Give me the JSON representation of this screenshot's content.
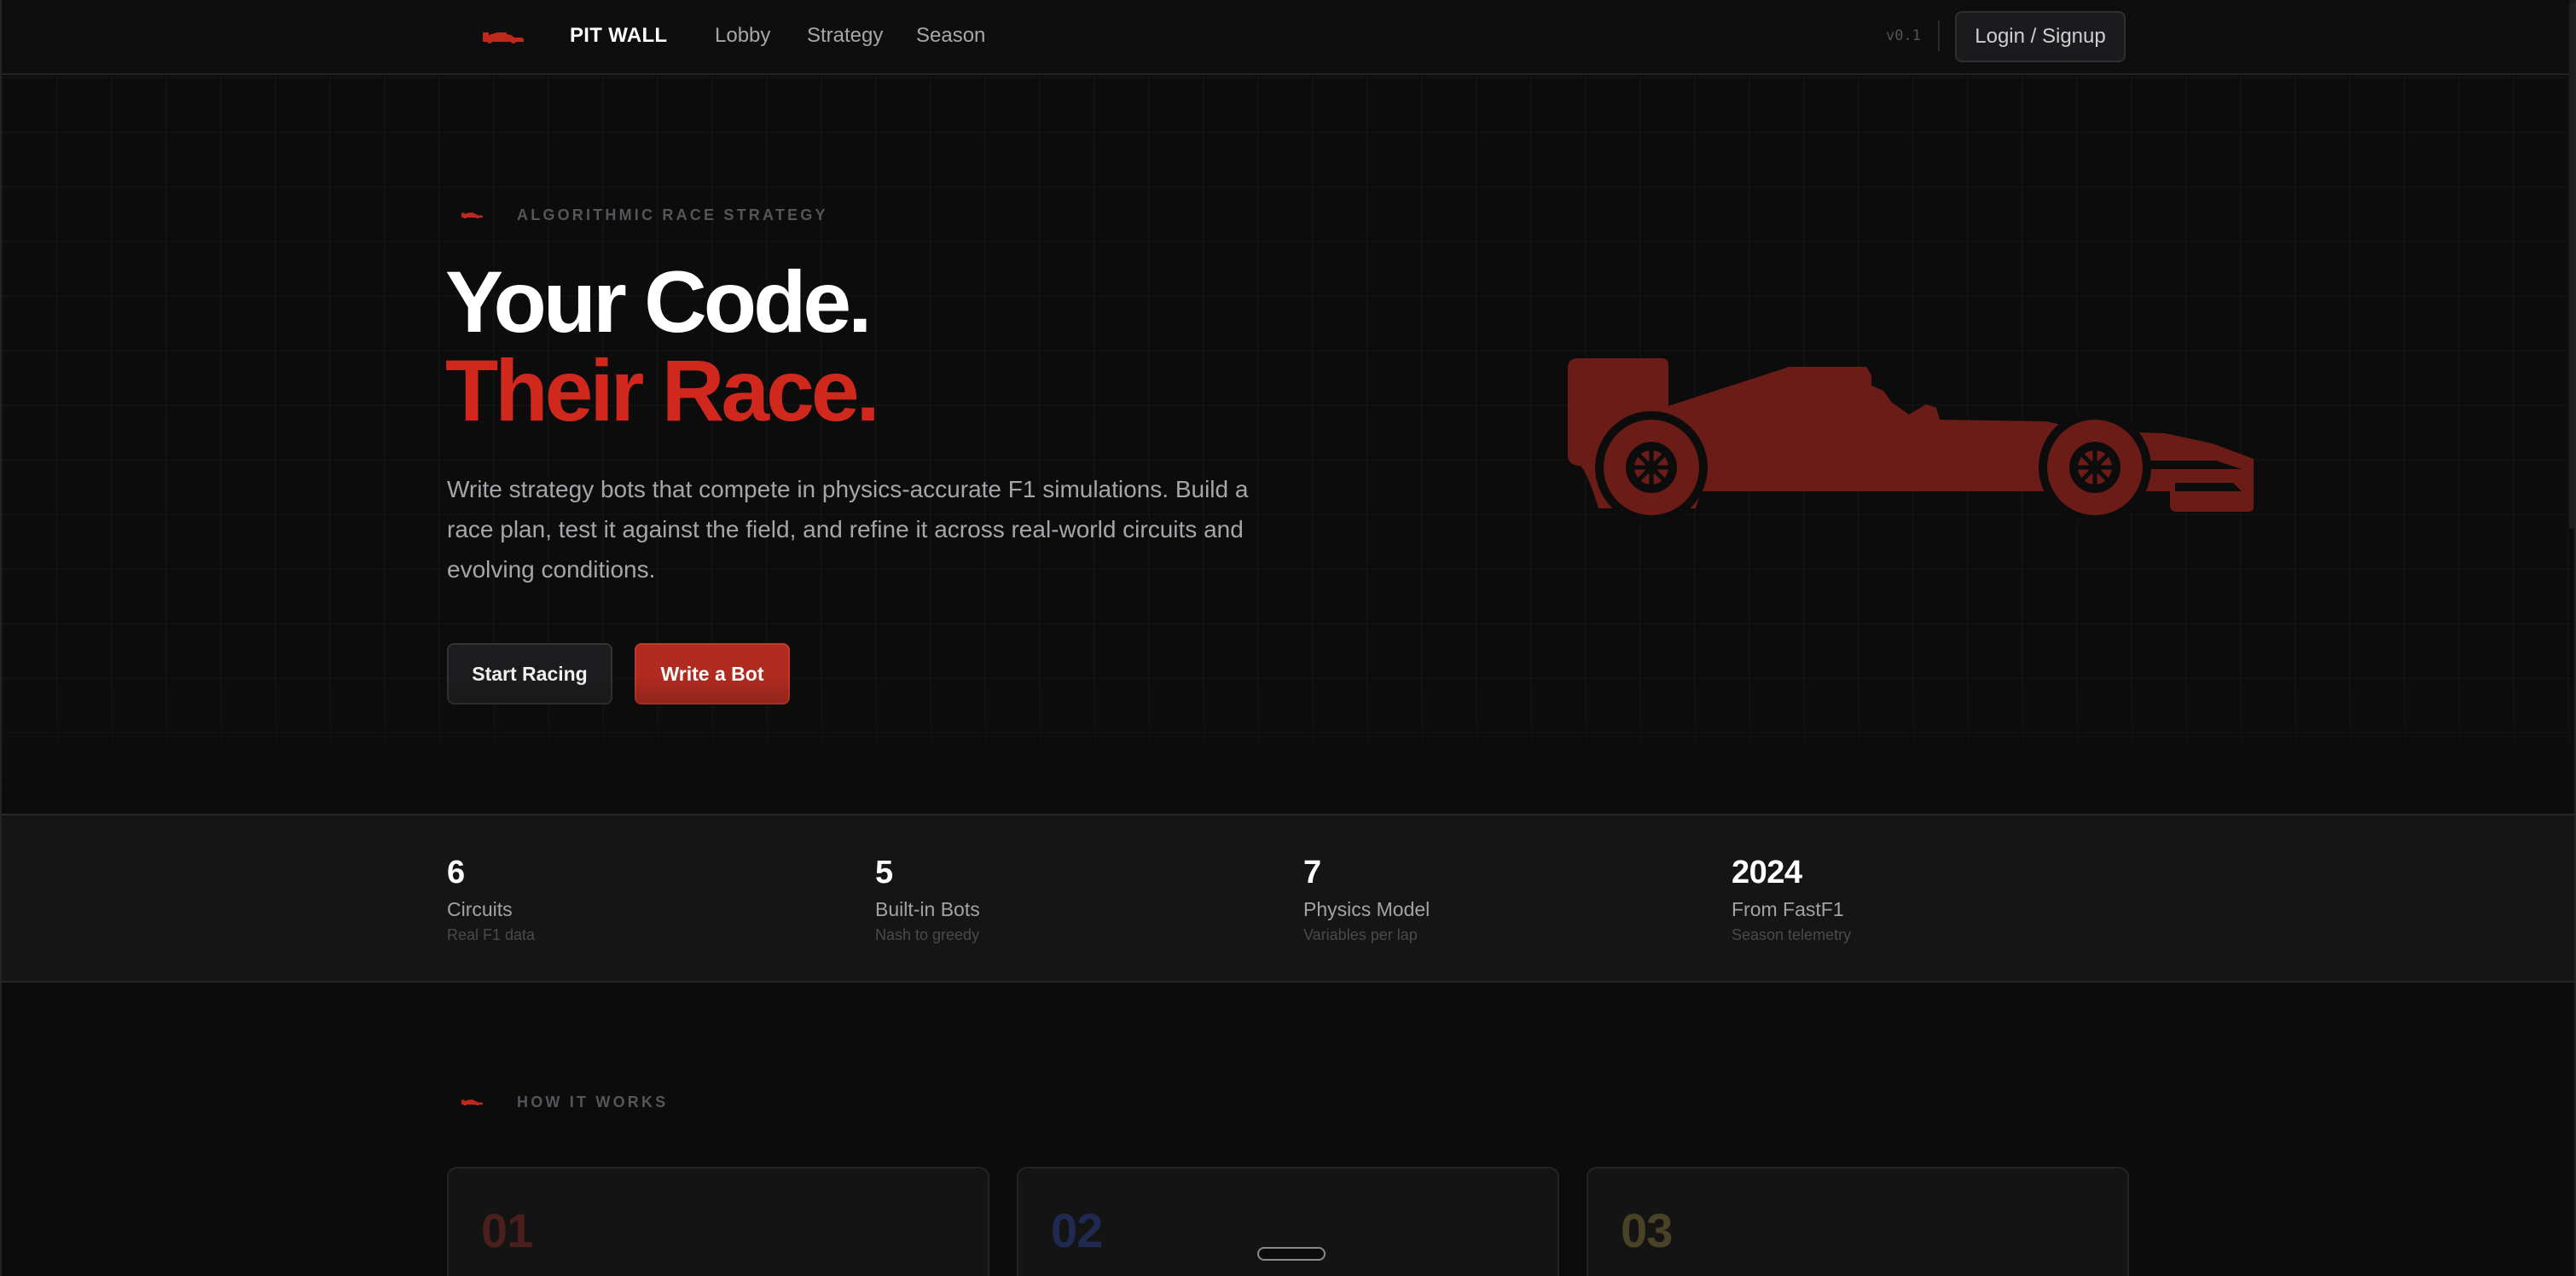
{
  "colors": {
    "accent": "#d0281c",
    "button_red": "#b02a20",
    "car_red": "#6b1c17",
    "step1": "#4a1f1c",
    "step2": "#1f2a52",
    "step3": "#4a4226"
  },
  "nav": {
    "logo_icon": "f1-car-icon",
    "brand": "PIT WALL",
    "links": [
      "Lobby",
      "Strategy",
      "Season"
    ],
    "version": "v0.1",
    "login_label": "Login / Signup"
  },
  "hero": {
    "eyebrow_icon": "f1-car-icon",
    "eyebrow": "ALGORITHMIC RACE STRATEGY",
    "title_line1": "Your Code.",
    "title_line2": "Their Race.",
    "description": "Write strategy bots that compete in physics-accurate F1 simulations. Build a race plan, test it against the field, and refine it across real-world circuits and evolving conditions.",
    "primary_button": "Start Racing",
    "secondary_button": "Write a Bot",
    "illustration": "f1-car-silhouette"
  },
  "stats": [
    {
      "value": "6",
      "label": "Circuits",
      "sub": "Real F1 data"
    },
    {
      "value": "5",
      "label": "Built-in Bots",
      "sub": "Nash to greedy"
    },
    {
      "value": "7",
      "label": "Physics Model",
      "sub": "Variables per lap"
    },
    {
      "value": "2024",
      "label": "From FastF1",
      "sub": "Season telemetry"
    }
  ],
  "how_it_works": {
    "eyebrow_icon": "f1-car-icon",
    "eyebrow": "HOW IT WORKS",
    "steps": [
      {
        "number": "01"
      },
      {
        "number": "02"
      },
      {
        "number": "03"
      }
    ]
  }
}
